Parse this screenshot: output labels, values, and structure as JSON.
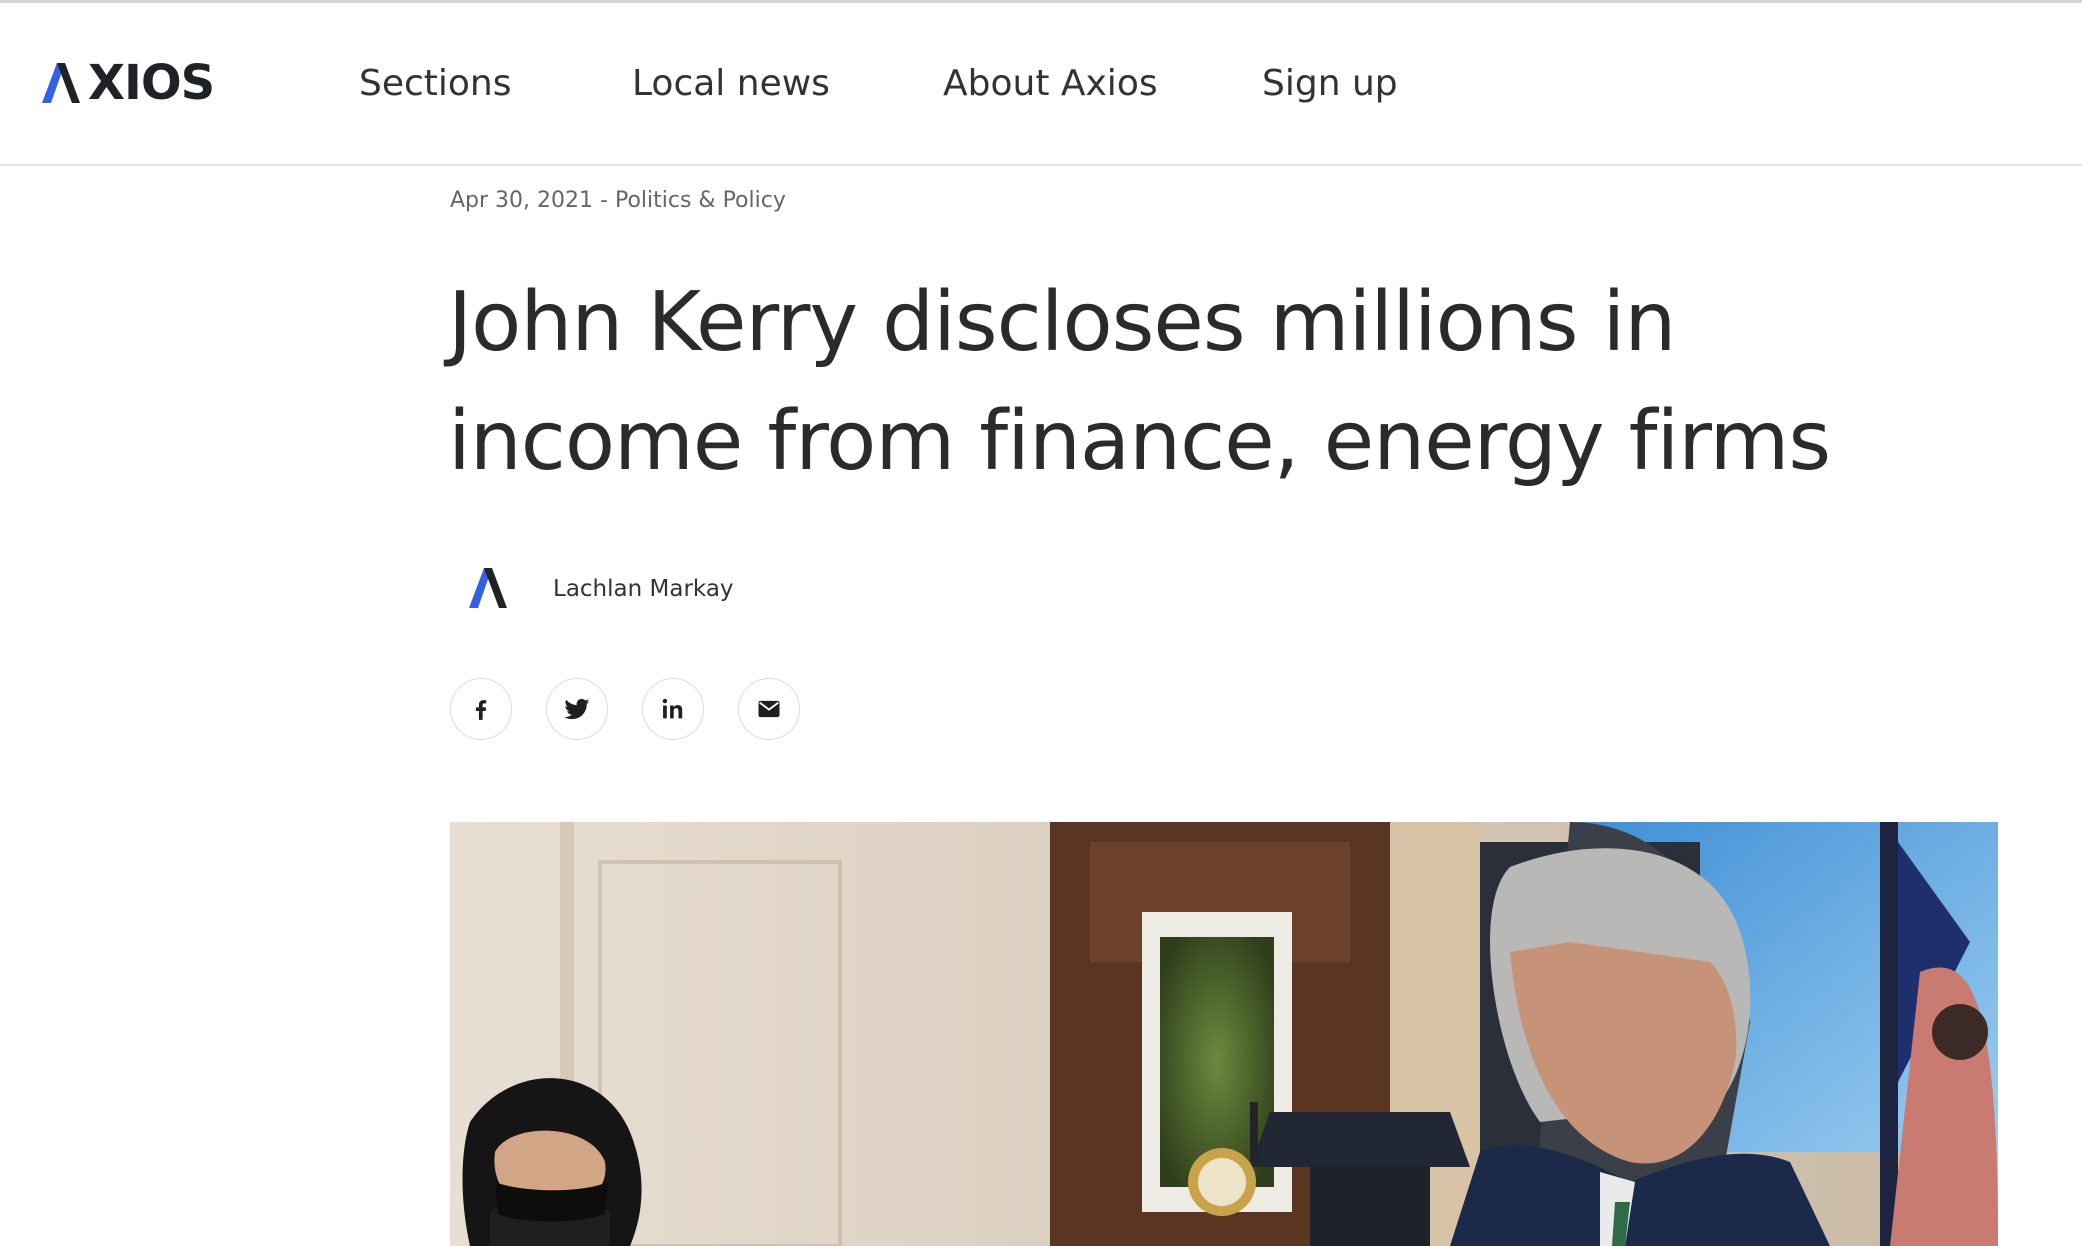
{
  "brand": {
    "logo_text": "XIOS",
    "logo_alt": "AXIOS",
    "accent_blue": "#3560e0",
    "dark": "#1f2328"
  },
  "nav": {
    "items": [
      {
        "label": "Sections"
      },
      {
        "label": "Local news"
      },
      {
        "label": "About Axios"
      },
      {
        "label": "Sign up"
      }
    ]
  },
  "article": {
    "date": "Apr 30, 2021",
    "separator": " - ",
    "category": "Politics & Policy",
    "headline_line1": "John Kerry discloses millions in",
    "headline_line2": "income from finance, energy firms",
    "author": "Lachlan Markay"
  },
  "share": {
    "buttons": [
      {
        "name": "facebook",
        "icon": "facebook-icon"
      },
      {
        "name": "twitter",
        "icon": "twitter-icon"
      },
      {
        "name": "linkedin",
        "icon": "linkedin-icon"
      },
      {
        "name": "email",
        "icon": "email-icon"
      }
    ]
  },
  "hero_image": {
    "description_icon": "photo-image"
  }
}
